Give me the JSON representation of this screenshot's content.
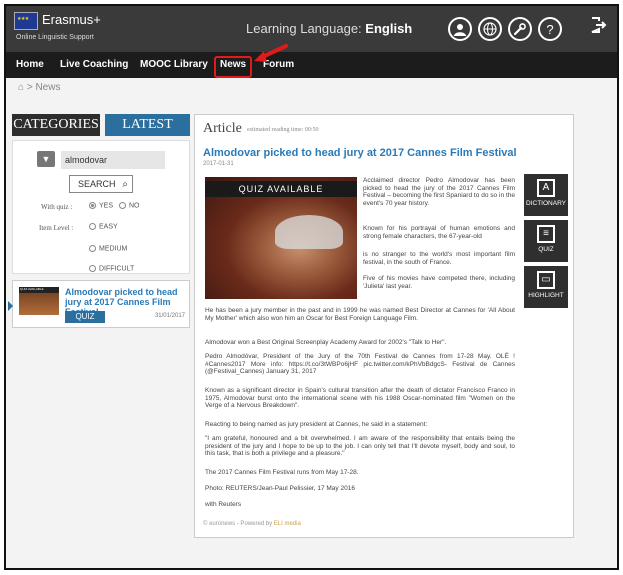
{
  "header": {
    "logo_name": "Erasmus+",
    "logo_sub": "Online Linguistic Support",
    "learning_label": "Learning Language:",
    "learning_lang": "English",
    "icons": [
      "user-icon",
      "globe-icon",
      "wrench-icon",
      "help-icon",
      "logout-icon"
    ],
    "help_glyph": "?"
  },
  "nav": {
    "items": [
      "Home",
      "Live Coaching",
      "MOOC Library",
      "News",
      "Forum"
    ],
    "active": "News"
  },
  "breadcrumb": {
    "separator": ">",
    "current": "News"
  },
  "left": {
    "categories_tab": "CATEGORIES",
    "latest_tab": "LATEST",
    "filter_value": "almodovar",
    "search_label": "SEARCH",
    "with_quiz_label": "With quiz :",
    "quiz_yes": "YES",
    "quiz_no": "NO",
    "item_level_label": "Item Level :",
    "levels": [
      "EASY",
      "MEDIUM",
      "DIFFICULT"
    ]
  },
  "result": {
    "badge": "QUIZ AVAILABLE",
    "title": "Almodovar picked to head jury at 2017 Cannes Film Festival",
    "quiz_button": "QUIZ",
    "date": "31/01/2017"
  },
  "article": {
    "heading": "Article",
    "reading_time": "estimated reading time: 00:50",
    "title": "Almodovar picked to head jury at 2017 Cannes Film Festival",
    "date": "2017-01-31",
    "quiz_banner": "QUIZ AVAILABLE",
    "paragraphs": [
      "Acclaimed director Pedro Almodovar has been picked to head the jury of the 2017 Cannes Film Festival – becoming the first Spaniard to do so in the event's 70 year history.",
      "Known for his portrayal of human emotions and strong female characters, the 67-year-old",
      "is no stranger to the world's most important film festival, in the south of France.",
      "Five of his movies have competed there, including 'Julieta' last year.",
      "He has been a jury member in the past and in 1999 he was named Best Director at Cannes for 'All About My Mother' which also won him an Oscar for Best Foreign Language Film.",
      "Almodovar won a Best Original Screenplay Academy Award for 2002's \"Talk to Her\".",
      "Pedro Almodóvar, President of the Jury of the 70th Festival de Cannes from 17-28 May. OLÉ ! #Cannes2017 More info: https://t.co/3tWBPo6jHF pic.twitter.com/kPhVbBdgcS- Festival de Cannes (@Festival_Cannes) January 31, 2017",
      "Known as a significant director in Spain's cultural transition after the death of dictator Francisco Franco in 1975, Almodovar burst onto the international scene with his 1988 Oscar-nominated film \"Women on the Verge of a Nervous Breakdown\".",
      "Reacting to being named as jury president at Cannes, he said in a statement:",
      "\"I am grateful, honoured and a bit overwhelmed. I am aware of the responsibility that entails being the president of the jury and I hope to be up to the job. I can only tell that I'll devote myself, body and soul, to this task, that is both a privilege and a pleasure.\"",
      "The 2017 Cannes Film Festival runs from May 17-28.",
      "Photo: REUTERS/Jean-Paul Pelissier, 17 May 2016",
      "with Reuters"
    ],
    "footer": "© euronews - Powered by",
    "footer_brand": "ELI media"
  },
  "tools": [
    "DICTIONARY",
    "QUIZ",
    "HIGHLIGHT"
  ],
  "colors": {
    "accent": "#2a7ab8",
    "highlight": "#e01b1b"
  }
}
